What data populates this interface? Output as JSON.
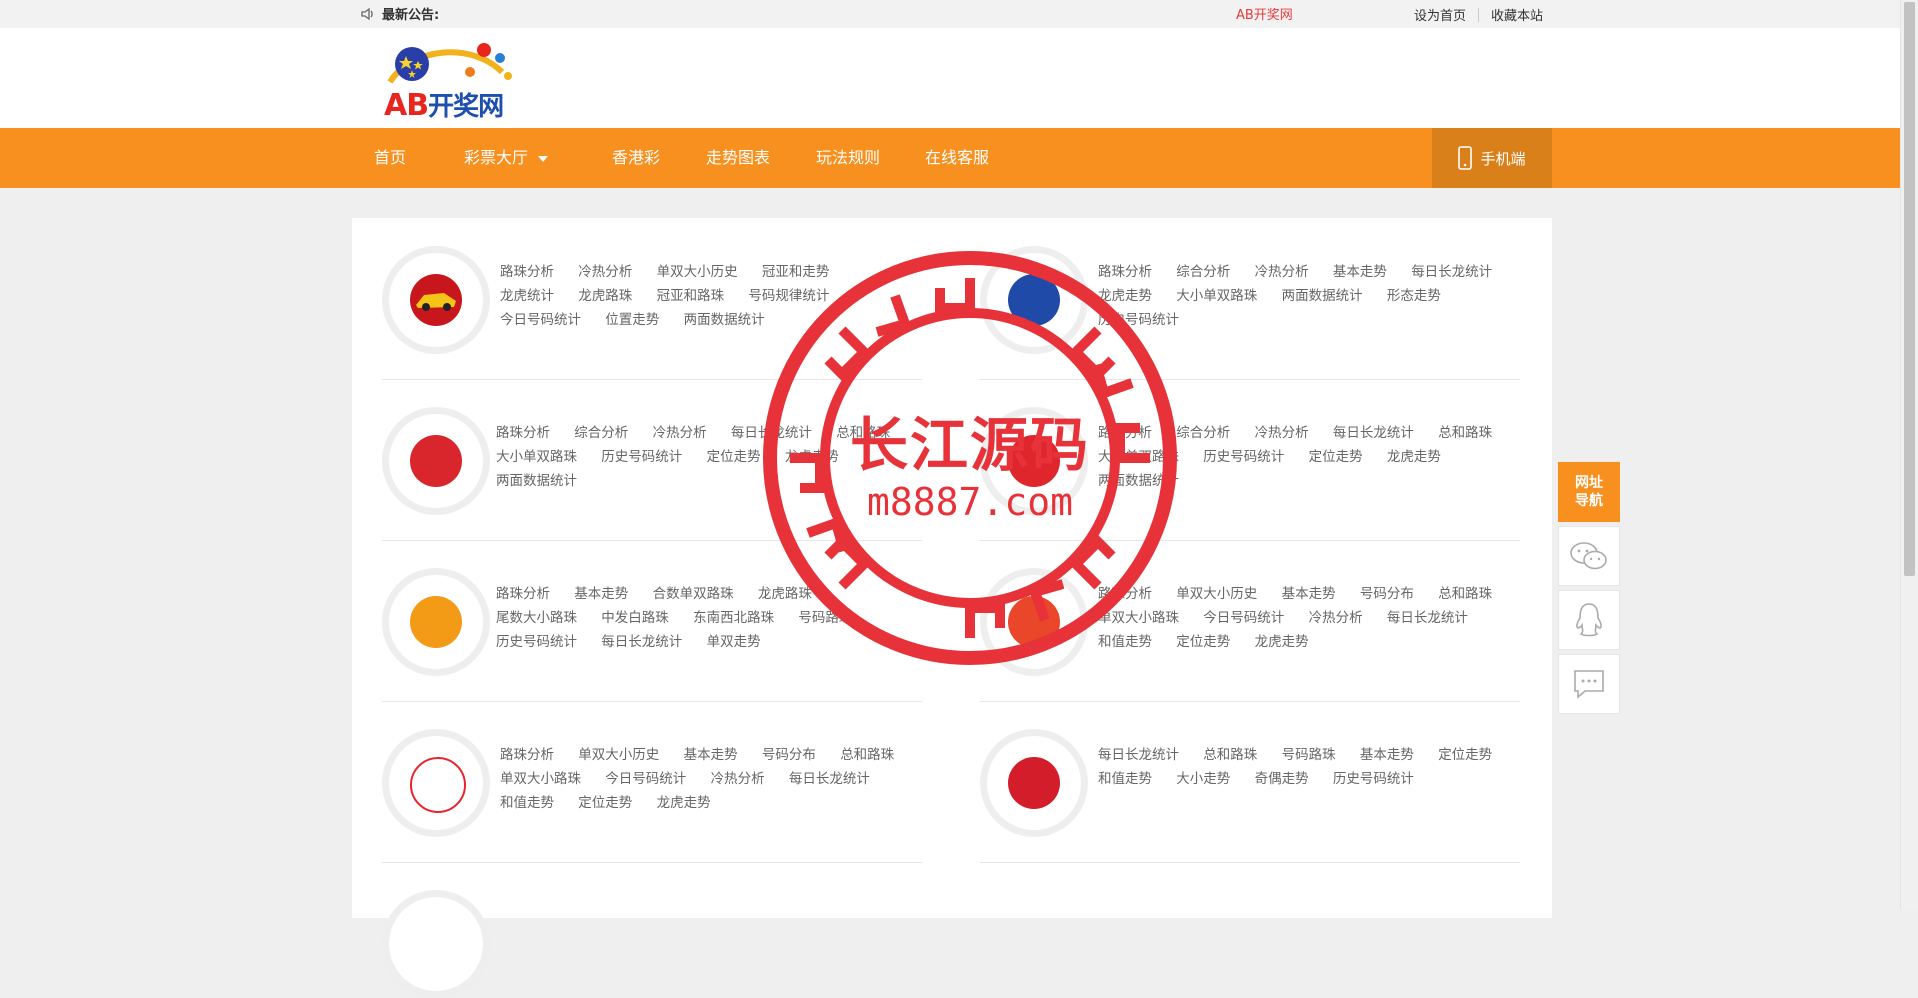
{
  "topbar": {
    "notice_label": "最新公告:",
    "brand_link": "AB开奖网",
    "set_home": "设为首页",
    "bookmark": "收藏本站"
  },
  "logo": {
    "ab": "AB",
    "cn": "开奖网"
  },
  "nav": {
    "items": [
      "首页",
      "彩票大厅",
      "香港彩",
      "走势图表",
      "玩法规则",
      "在线客服"
    ],
    "mobile": "手机端"
  },
  "cards": [
    {
      "links": [
        "路珠分析",
        "冷热分析",
        "单双大小历史",
        "冠亚和走势",
        "龙虎统计",
        "龙虎路珠",
        "冠亚和路珠",
        "号码规律统计",
        "今日号码统计",
        "位置走势",
        "两面数据统计"
      ]
    },
    {
      "links": [
        "路珠分析",
        "综合分析",
        "冷热分析",
        "基本走势",
        "每日长龙统计",
        "龙虎走势",
        "大小单双路珠",
        "两面数据统计",
        "形态走势",
        "历史号码统计"
      ]
    },
    {
      "links": [
        "路珠分析",
        "综合分析",
        "冷热分析",
        "每日长龙统计",
        "总和路珠",
        "大小单双路珠",
        "历史号码统计",
        "定位走势",
        "龙虎走势",
        "两面数据统计"
      ]
    },
    {
      "links": [
        "路珠分析",
        "综合分析",
        "冷热分析",
        "每日长龙统计",
        "总和路珠",
        "大小单双路珠",
        "历史号码统计",
        "定位走势",
        "龙虎走势",
        "两面数据统计"
      ]
    },
    {
      "links": [
        "路珠分析",
        "基本走势",
        "合数单双路珠",
        "龙虎路珠",
        "尾数大小路珠",
        "中发白路珠",
        "东南西北路珠",
        "号码路珠",
        "历史号码统计",
        "每日长龙统计",
        "单双走势"
      ]
    },
    {
      "links": [
        "路珠分析",
        "单双大小历史",
        "基本走势",
        "号码分布",
        "总和路珠",
        "单双大小路珠",
        "今日号码统计",
        "冷热分析",
        "每日长龙统计",
        "和值走势",
        "定位走势",
        "龙虎走势"
      ]
    },
    {
      "links": [
        "路珠分析",
        "单双大小历史",
        "基本走势",
        "号码分布",
        "总和路珠",
        "单双大小路珠",
        "今日号码统计",
        "冷热分析",
        "每日长龙统计",
        "和值走势",
        "定位走势",
        "龙虎走势"
      ]
    },
    {
      "links": [
        "每日长龙统计",
        "总和路珠",
        "号码路珠",
        "基本走势",
        "定位走势",
        "和值走势",
        "大小走势",
        "奇偶走势",
        "历史号码统计"
      ]
    }
  ],
  "float_tools": {
    "site_nav": [
      "网址",
      "导航"
    ]
  },
  "stamp": {
    "line1": "长江源码",
    "line2": "m8887.com"
  },
  "colors": {
    "orange": "#f7901e",
    "stamp_red": "#e63238"
  }
}
